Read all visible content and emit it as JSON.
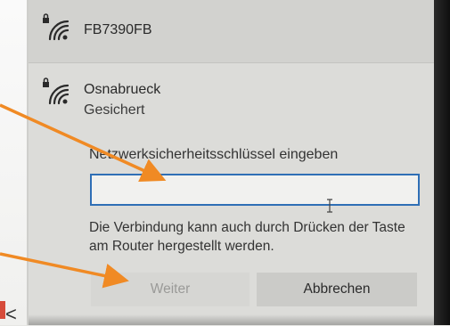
{
  "networks": [
    {
      "ssid": "FB7390FB",
      "icon": "wifi-secured-icon"
    },
    {
      "ssid": "Osnabrueck",
      "status": "Gesichert",
      "icon": "wifi-secured-icon"
    }
  ],
  "key_field": {
    "label": "Netzwerksicherheitsschlüssel eingeben",
    "value": "",
    "placeholder": ""
  },
  "help_text": "Die Verbindung kann auch durch Drücken der Taste am Router hergestellt werden.",
  "buttons": {
    "next_label": "Weiter",
    "cancel_label": "Abbrechen"
  },
  "colors": {
    "input_border": "#2f6fb6",
    "annotation_arrow": "#f08a24"
  }
}
